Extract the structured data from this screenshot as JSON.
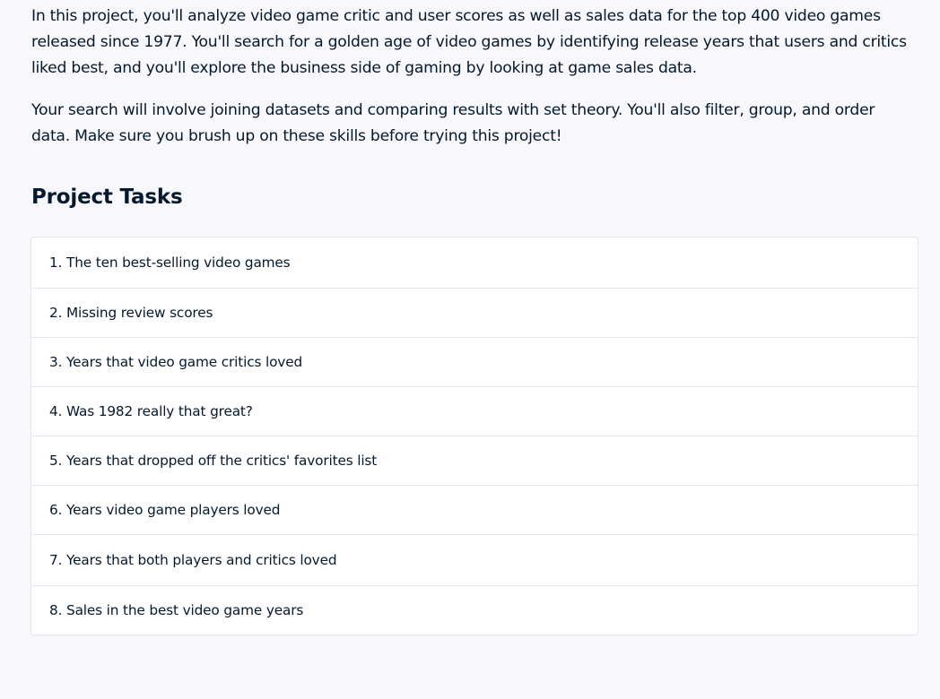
{
  "intro": {
    "paragraph_1": "In this project, you'll analyze video game critic and user scores as well as sales data for the top 400 video games released since 1977. You'll search for a golden age of video games by identifying release years that users and critics liked best, and you'll explore the business side of gaming by looking at game sales data.",
    "paragraph_2": "Your search will involve joining datasets and comparing results with set theory. You'll also filter, group, and order data. Make sure you brush up on these skills before trying this project!"
  },
  "section_title": "Project Tasks",
  "tasks": [
    "1. The ten best-selling video games",
    "2. Missing review scores",
    "3. Years that video game critics loved",
    "4. Was 1982 really that great?",
    "5. Years that dropped off the critics' favorites list",
    "6. Years video game players loved",
    "7. Years that both players and critics loved",
    "8. Sales in the best video game years"
  ]
}
